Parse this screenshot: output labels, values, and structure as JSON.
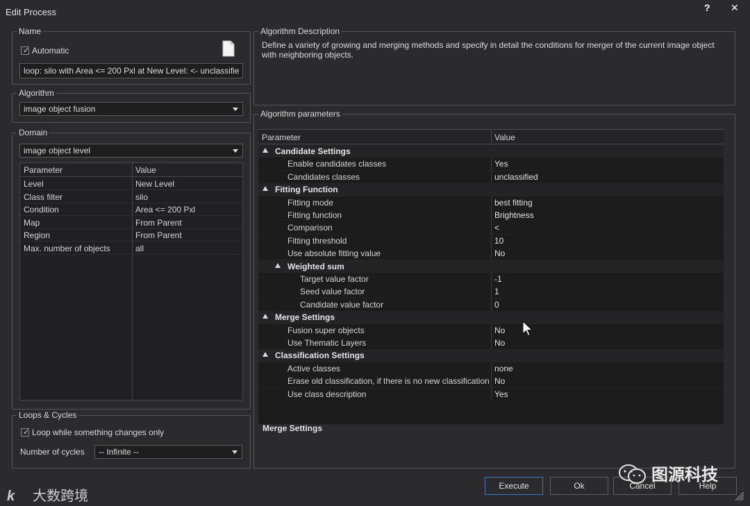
{
  "window": {
    "title": "Edit Process",
    "help_label": "?",
    "close_label": "✕"
  },
  "name_group": {
    "legend": "Name",
    "automatic_label": "Automatic",
    "automatic_checked": true,
    "name_value": "loop: silo with Area <= 200 Pxl at  New Level: <- unclassifie",
    "icon": "document-icon"
  },
  "algorithm_group": {
    "legend": "Algorithm",
    "selected": "image object fusion"
  },
  "domain_group": {
    "legend": "Domain",
    "selected": "image object level",
    "columns": [
      "Parameter",
      "Value"
    ],
    "rows": [
      {
        "param": "Level",
        "value": "New Level"
      },
      {
        "param": "Class filter",
        "value": "silo"
      },
      {
        "param": "Condition",
        "value": "Area <= 200 Pxl"
      },
      {
        "param": "Map",
        "value": "From Parent"
      },
      {
        "param": "Region",
        "value": "From Parent"
      },
      {
        "param": "Max. number of objects",
        "value": "all"
      }
    ]
  },
  "loops_group": {
    "legend": "Loops & Cycles",
    "loop_label": "Loop while something changes only",
    "loop_checked": true,
    "cycles_label": "Number of cycles",
    "cycles_value": "-- Infinite --"
  },
  "description_group": {
    "legend": "Algorithm Description",
    "text": "Define a variety of growing and merging methods and specify in detail the conditions for merger of the current image object with neighboring objects."
  },
  "parameters_group": {
    "legend": "Algorithm parameters",
    "columns": [
      "Parameter",
      "Value"
    ],
    "rows": [
      {
        "kind": "group",
        "level": 0,
        "name": "Candidate Settings",
        "value": ""
      },
      {
        "kind": "item",
        "level": 1,
        "name": "Enable candidates classes",
        "value": "Yes"
      },
      {
        "kind": "item",
        "level": 1,
        "name": "Candidates classes",
        "value": "unclassified"
      },
      {
        "kind": "group",
        "level": 0,
        "name": "Fitting Function",
        "value": ""
      },
      {
        "kind": "item",
        "level": 1,
        "name": "Fitting mode",
        "value": "best fitting"
      },
      {
        "kind": "item",
        "level": 1,
        "name": "Fitting function",
        "value": "Brightness"
      },
      {
        "kind": "item",
        "level": 1,
        "name": "Comparison",
        "value": "<"
      },
      {
        "kind": "item",
        "level": 1,
        "name": "Fitting threshold",
        "value": "10"
      },
      {
        "kind": "item",
        "level": 1,
        "name": "Use absolute fitting value",
        "value": "No"
      },
      {
        "kind": "group",
        "level": 1,
        "name": "Weighted sum",
        "value": ""
      },
      {
        "kind": "item",
        "level": 2,
        "name": "Target value factor",
        "value": "-1"
      },
      {
        "kind": "item",
        "level": 2,
        "name": "Seed value factor",
        "value": "1"
      },
      {
        "kind": "item",
        "level": 2,
        "name": "Candidate value factor",
        "value": "0"
      },
      {
        "kind": "group",
        "level": 0,
        "name": "Merge Settings",
        "value": ""
      },
      {
        "kind": "item",
        "level": 1,
        "name": "Fusion super objects",
        "value": "No"
      },
      {
        "kind": "item",
        "level": 1,
        "name": "Use Thematic Layers",
        "value": "No"
      },
      {
        "kind": "group",
        "level": 0,
        "name": "Classification Settings",
        "value": ""
      },
      {
        "kind": "item",
        "level": 1,
        "name": "Active classes",
        "value": "none"
      },
      {
        "kind": "item",
        "level": 1,
        "name": "Erase old classification, if there is no new classification",
        "value": "No"
      },
      {
        "kind": "item",
        "level": 1,
        "name": "Use class description",
        "value": "Yes"
      }
    ],
    "footer_title": "Merge Settings"
  },
  "buttons": {
    "execute": "Execute",
    "ok": "Ok",
    "cancel": "Cancel",
    "help": "Help"
  },
  "watermarks": {
    "left": "大数跨境",
    "right": "图源科技"
  }
}
